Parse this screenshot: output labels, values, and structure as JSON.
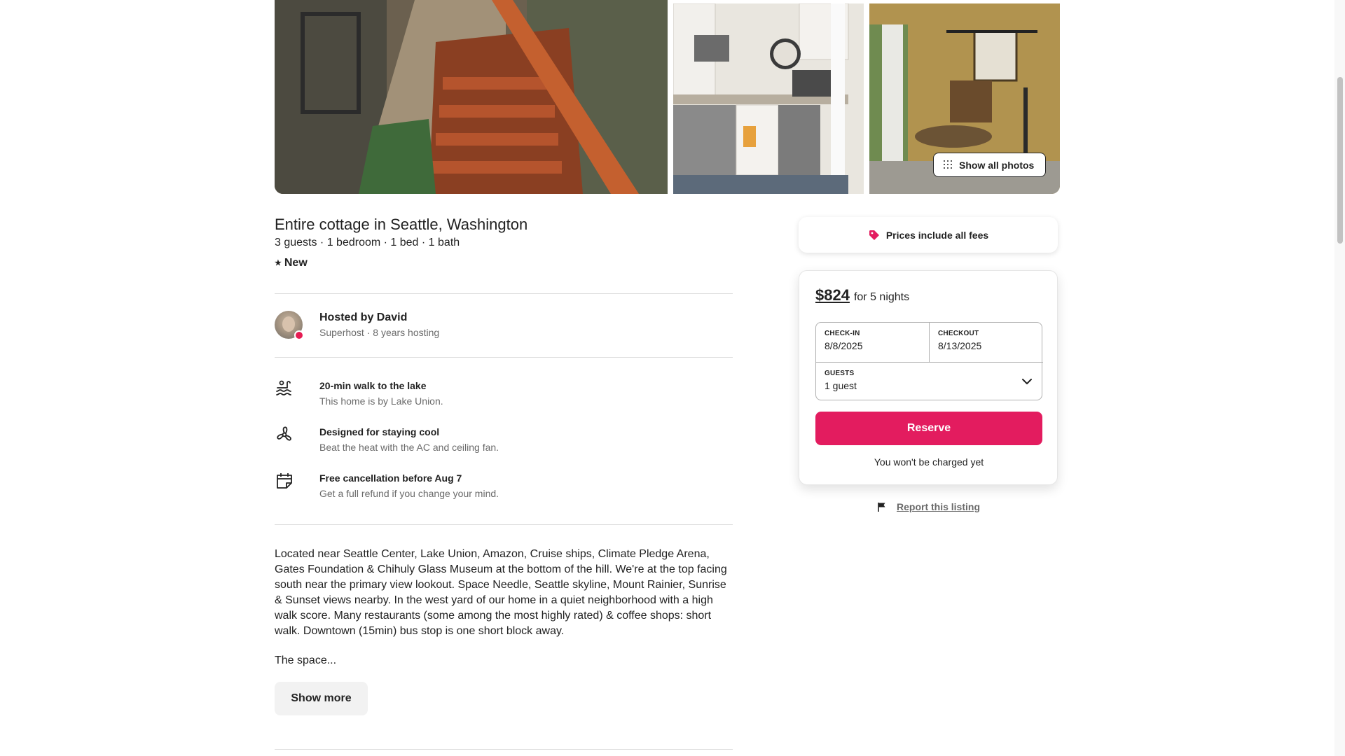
{
  "gallery": {
    "show_all_label": "Show all photos"
  },
  "listing": {
    "title": "Entire cottage in Seattle, Washington",
    "summary": "3 guests · 1 bedroom · 1 bed · 1 bath",
    "rating_label": "New",
    "rating_icon": "star-icon"
  },
  "host": {
    "name": "Hosted by David",
    "meta": "Superhost · 8 years hosting"
  },
  "highlights": [
    {
      "icon": "lake-icon",
      "title": "20-min walk to the lake",
      "desc": "This home is by Lake Union."
    },
    {
      "icon": "fan-icon",
      "title": "Designed for staying cool",
      "desc": "Beat the heat with the AC and ceiling fan."
    },
    {
      "icon": "calendar-icon",
      "title": "Free cancellation before Aug 7",
      "desc": "Get a full refund if you change your mind."
    }
  ],
  "description": {
    "text": "Located near Seattle Center, Lake Union, Amazon, Cruise ships,  Climate Pledge Arena, Gates Foundation & Chihuly Glass Museum at the bottom of the hill. We're at the top facing south near the primary view lookout. Space Needle, Seattle skyline, Mount Rainier, Sunrise & Sunset views nearby. In the west yard of our home in a quiet neighborhood with a high walk score. Many restaurants (some among the most highly rated) & coffee shops: short walk. Downtown (15min) bus stop is one short block away.",
    "space_label": "The space...",
    "show_more_label": "Show more"
  },
  "fees": {
    "label": "Prices include all fees",
    "tag_color": "#e31c5f"
  },
  "booking": {
    "price": "$824",
    "period": "for 5 nights",
    "checkin_label": "CHECK-IN",
    "checkin_value": "8/8/2025",
    "checkout_label": "CHECKOUT",
    "checkout_value": "8/13/2025",
    "guests_label": "GUESTS",
    "guests_value": "1 guest",
    "reserve_label": "Reserve",
    "reserve_color": "#e31c5f",
    "note": "You won't be charged yet"
  },
  "report": {
    "label": "Report this listing"
  }
}
